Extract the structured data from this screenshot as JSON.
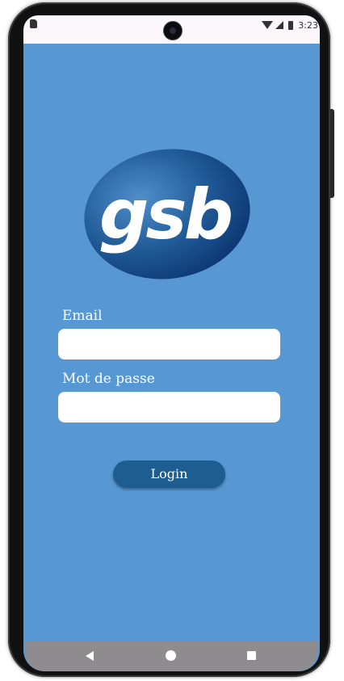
{
  "status_bar": {
    "time": "3:23"
  },
  "logo": {
    "text": "gsb"
  },
  "form": {
    "email_label": "Email",
    "email_value": "",
    "password_label": "Mot de passe",
    "password_value": "",
    "login_label": "Login"
  },
  "icons": {
    "wifi": "wifi-icon",
    "signal": "signal-icon",
    "battery": "battery-icon",
    "back": "back-icon",
    "home": "home-icon",
    "recents": "recents-icon"
  },
  "colors": {
    "background": "#5797d4",
    "button": "#1d5d8f",
    "logo_dark": "#0f3d78",
    "logo_light": "#3a78b8"
  }
}
